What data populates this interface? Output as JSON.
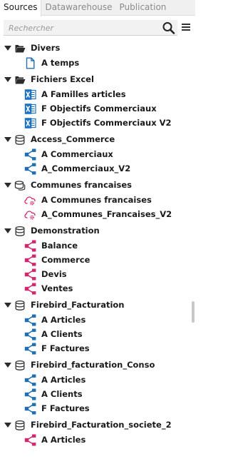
{
  "tabs": [
    {
      "label": "Sources",
      "active": true
    },
    {
      "label": "Datawarehouse",
      "active": false
    },
    {
      "label": "Publication",
      "active": false
    }
  ],
  "search": {
    "placeholder": "Rechercher",
    "value": ""
  },
  "colors": {
    "excel": "#1e73be",
    "blue": "#1f6fb5",
    "pink": "#d6246e",
    "folder": "#2b2b2b"
  },
  "tree": [
    {
      "label": "Divers",
      "icon": "folder-open-icon",
      "children": [
        {
          "label": "A temps",
          "icon": "document-icon"
        }
      ]
    },
    {
      "label": "Fichiers Excel",
      "icon": "folder-open-icon",
      "children": [
        {
          "label": "A Familles articles",
          "icon": "excel-file-icon"
        },
        {
          "label": "F Objectifs Commerciaux",
          "icon": "excel-file-icon"
        },
        {
          "label": "F Objectifs Commerciaux V2",
          "icon": "excel-file-icon"
        }
      ]
    },
    {
      "label": "Access_Commerce",
      "icon": "database-icon",
      "children": [
        {
          "label": "A Commerciaux",
          "icon": "hierarchy-blue-icon"
        },
        {
          "label": "A_Commerciaux_V2",
          "icon": "hierarchy-blue-icon"
        }
      ]
    },
    {
      "label": "Communes francaises",
      "icon": "database-stack-icon",
      "children": [
        {
          "label": "A Communes francaises",
          "icon": "cloud-gear-icon"
        },
        {
          "label": "A_Communes_Francaises_V2",
          "icon": "cloud-gear-icon"
        }
      ]
    },
    {
      "label": "Demonstration",
      "icon": "database-icon",
      "children": [
        {
          "label": "Balance",
          "icon": "hierarchy-pink-icon"
        },
        {
          "label": "Commerce",
          "icon": "hierarchy-pink-icon"
        },
        {
          "label": "Devis",
          "icon": "hierarchy-pink-icon"
        },
        {
          "label": "Ventes",
          "icon": "hierarchy-pink-icon"
        }
      ]
    },
    {
      "label": "Firebird_Facturation",
      "icon": "database-icon",
      "children": [
        {
          "label": "A Articles",
          "icon": "hierarchy-blue-icon"
        },
        {
          "label": "A Clients",
          "icon": "hierarchy-blue-icon"
        },
        {
          "label": "F Factures",
          "icon": "hierarchy-blue-icon"
        }
      ]
    },
    {
      "label": "Firebird_facturation_Conso",
      "icon": "database-icon",
      "children": [
        {
          "label": "A Articles",
          "icon": "hierarchy-blue-icon"
        },
        {
          "label": "A Clients",
          "icon": "hierarchy-blue-icon"
        },
        {
          "label": "F Factures",
          "icon": "hierarchy-blue-icon"
        }
      ]
    },
    {
      "label": "Firebird_Facturation_societe_2",
      "icon": "database-icon",
      "children": [
        {
          "label": "A Articles",
          "icon": "hierarchy-pink-icon"
        }
      ]
    }
  ]
}
